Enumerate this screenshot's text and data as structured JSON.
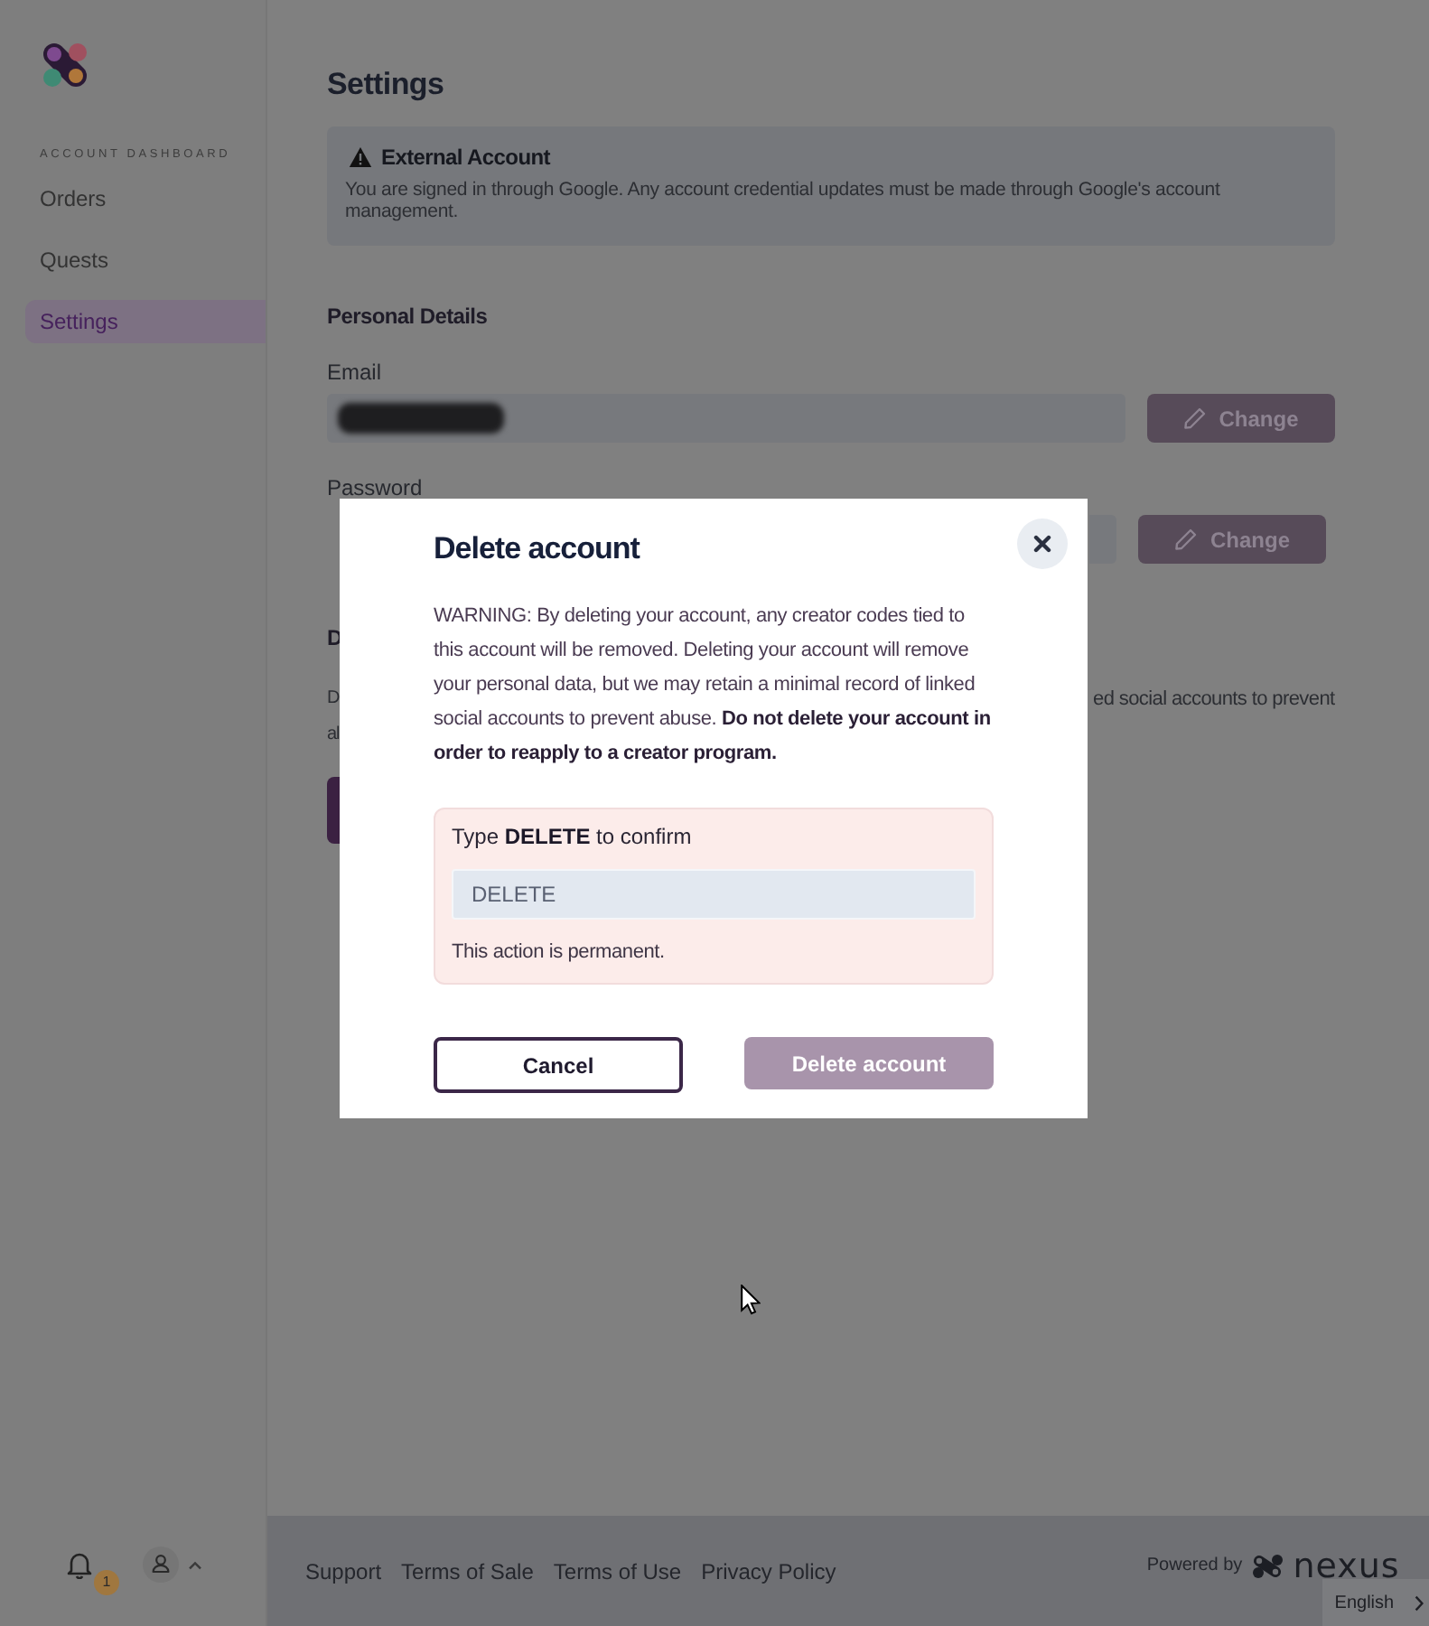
{
  "sidebar": {
    "section_label": "ACCOUNT DASHBOARD",
    "items": [
      {
        "label": "Orders",
        "selected": false
      },
      {
        "label": "Quests",
        "selected": false
      },
      {
        "label": "Settings",
        "selected": true
      }
    ],
    "notification_count": "1"
  },
  "page": {
    "title": "Settings",
    "notice": {
      "title": "External Account",
      "text": "You are signed in through Google. Any account credential updates must be made through Google's account management."
    },
    "personal_details": {
      "heading": "Personal Details",
      "email": {
        "label": "Email",
        "value_redacted": true,
        "button": "Change"
      },
      "password": {
        "label": "Password",
        "button": "Change"
      }
    },
    "covered_section": {
      "heading": "D",
      "lines": [
        {
          "left": "D",
          "right": "ed social accounts to prevent"
        },
        {
          "left": "al"
        }
      ]
    }
  },
  "modal": {
    "title": "Delete account",
    "warning": "WARNING: By deleting your account, any creator codes tied to this account will be removed. Deleting your account will remove your personal data, but we may retain a minimal record of linked social accounts to prevent abuse. **Do not delete your account in order to reapply to a creator program.**",
    "confirm": {
      "prompt": "Type **DELETE** to confirm",
      "value": "DELETE",
      "note": "This action is permanent."
    },
    "buttons": [
      {
        "label": "Cancel",
        "kind": "secondary"
      },
      {
        "label": "Delete account",
        "kind": "primary"
      }
    ]
  },
  "footer": {
    "links": [
      "Support",
      "Terms of Sale",
      "Terms of Use",
      "Privacy Policy"
    ],
    "powered_by": "Powered by",
    "brand": "nexus",
    "language": "English"
  }
}
